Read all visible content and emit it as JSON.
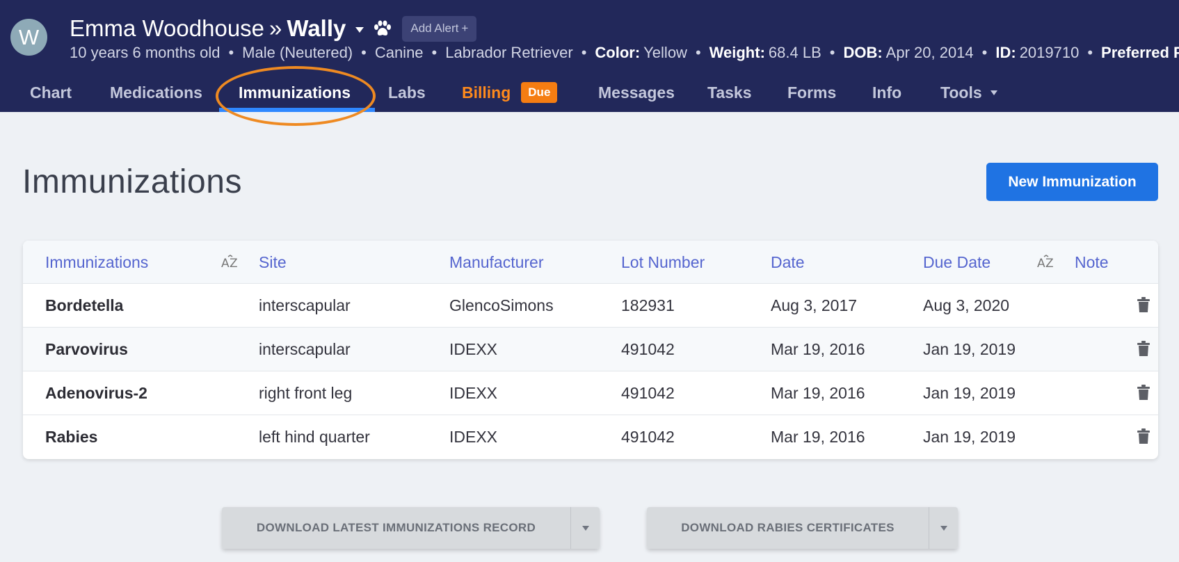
{
  "patient": {
    "avatar_letter": "W",
    "owner_name": "Emma Woodhouse",
    "separator": "»",
    "pet_name": "Wally",
    "add_alert_label": "Add Alert",
    "add_alert_plus": "+",
    "info": {
      "age": "10 years 6 months old",
      "sex": "Male (Neutered)",
      "species": "Canine",
      "breed": "Labrador Retriever",
      "color_label": "Color:",
      "color": "Yellow",
      "weight_label": "Weight:",
      "weight": "68.4 LB",
      "dob_label": "DOB:",
      "dob": "Apr 20, 2014",
      "id_label": "ID:",
      "id": "2019710",
      "phone_label": "Preferred Phone:",
      "dot": "•"
    }
  },
  "nav": {
    "chart": "Chart",
    "medications": "Medications",
    "immunizations": "Immunizations",
    "labs": "Labs",
    "billing": "Billing",
    "billing_badge": "Due",
    "messages": "Messages",
    "tasks": "Tasks",
    "forms": "Forms",
    "info": "Info",
    "tools": "Tools"
  },
  "page": {
    "title": "Immunizations",
    "new_button": "New Immunization"
  },
  "table": {
    "headers": {
      "immunizations": "Immunizations",
      "site": "Site",
      "manufacturer": "Manufacturer",
      "lot_number": "Lot Number",
      "date": "Date",
      "due_date": "Due Date",
      "note": "Note"
    },
    "rows": [
      {
        "name": "Bordetella",
        "site": "interscapular",
        "manufacturer": "GlencoSimons",
        "lot": "182931",
        "date": "Aug 3, 2017",
        "due": "Aug 3, 2020"
      },
      {
        "name": "Parvovirus",
        "site": "interscapular",
        "manufacturer": "IDEXX",
        "lot": "491042",
        "date": "Mar 19, 2016",
        "due": "Jan 19, 2019"
      },
      {
        "name": "Adenovirus-2",
        "site": "right front leg",
        "manufacturer": "IDEXX",
        "lot": "491042",
        "date": "Mar 19, 2016",
        "due": "Jan 19, 2019"
      },
      {
        "name": "Rabies",
        "site": "left hind quarter",
        "manufacturer": "IDEXX",
        "lot": "491042",
        "date": "Mar 19, 2016",
        "due": "Jan 19, 2019"
      }
    ]
  },
  "downloads": {
    "latest_record": "DOWNLOAD LATEST IMMUNIZATIONS RECORD",
    "rabies_certificates": "DOWNLOAD RABIES CERTIFICATES"
  },
  "colors": {
    "header_bg": "#22285a",
    "accent_blue": "#1f73e3",
    "billing_orange": "#ff8a1c",
    "header_link": "#5565cf",
    "highlight": "#ee8a22"
  },
  "icons": {
    "paw": "paw-icon",
    "sort": "sort-az-icon",
    "trash": "trash-icon",
    "caret": "caret-down-icon"
  }
}
